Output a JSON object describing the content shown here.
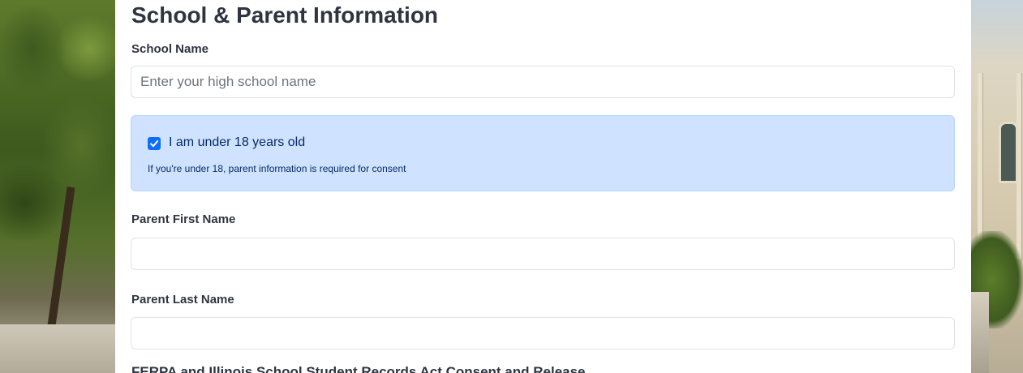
{
  "section": {
    "title": "School & Parent Information"
  },
  "school_name": {
    "label": "School Name",
    "placeholder": "Enter your high school name",
    "value": ""
  },
  "age_notice": {
    "checkbox_label": "I am under 18 years old",
    "checked": true,
    "hint": "If you're under 18, parent information is required for consent"
  },
  "parent_first_name": {
    "label": "Parent First Name",
    "value": ""
  },
  "parent_last_name": {
    "label": "Parent Last Name",
    "value": ""
  },
  "next_section_partial": {
    "label": "FERPA and Illinois School Student Records Act Consent and Release"
  },
  "colors": {
    "accent": "#0d6efd",
    "alert_bg": "#cfe2ff",
    "heading": "#2f3540"
  }
}
